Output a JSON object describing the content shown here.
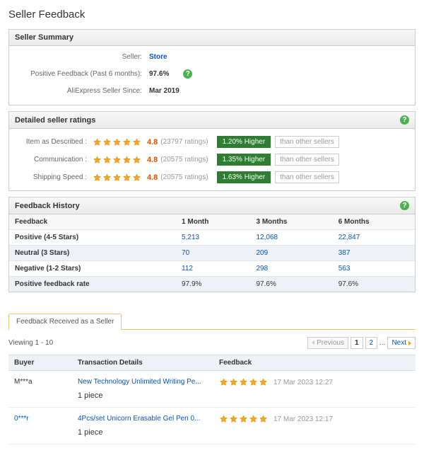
{
  "page_title": "Seller Feedback",
  "summary": {
    "header": "Seller Summary",
    "rows": {
      "seller_label": "Seller:",
      "seller_value": "Store",
      "positive_label": "Positive Feedback (Past 6 months):",
      "positive_value": "97.6%",
      "since_label": "AliExpress Seller Since:",
      "since_value": "Mar 2019"
    }
  },
  "detailed": {
    "header": "Detailed seller ratings",
    "rows": [
      {
        "label": "Item as Described :",
        "score": "4.8",
        "count": "(23797 ratings)",
        "badge": "1.20% Higher",
        "vs": "than other sellers"
      },
      {
        "label": "Communication :",
        "score": "4.8",
        "count": "(20575 ratings)",
        "badge": "1.35% Higher",
        "vs": "than other sellers"
      },
      {
        "label": "Shipping Speed :",
        "score": "4.8",
        "count": "(20575 ratings)",
        "badge": "1.63% Higher",
        "vs": "than other sellers"
      }
    ]
  },
  "history": {
    "header": "Feedback History",
    "cols": [
      "Feedback",
      "1 Month",
      "3 Months",
      "6 Months"
    ],
    "rows": [
      {
        "label": "Positive (4-5 Stars)",
        "v1": "5,213",
        "v2": "12,068",
        "v3": "22,847",
        "link": true
      },
      {
        "label": "Neutral (3 Stars)",
        "v1": "70",
        "v2": "209",
        "v3": "387",
        "link": true,
        "alt": true
      },
      {
        "label": "Negative (1-2 Stars)",
        "v1": "112",
        "v2": "298",
        "v3": "563",
        "link": true
      },
      {
        "label": "Positive feedback rate",
        "v1": "97.9%",
        "v2": "97.6%",
        "v3": "97.6%",
        "alt": true
      }
    ]
  },
  "feedback_list": {
    "tab_label": "Feedback Received as a Seller",
    "viewing": "Viewing 1 - 10",
    "pagination": {
      "prev": "Previous",
      "pages": [
        "1",
        "2"
      ],
      "ellipsis": "...",
      "next": "Next"
    },
    "cols": [
      "Buyer",
      "Transaction Details",
      "Feedback"
    ],
    "items": [
      {
        "buyer": "M***a",
        "buyer_dark": true,
        "trans": "New Technology Unlimited Writing Pe...",
        "qty": "1 piece",
        "date": "17 Mar 2023 12:27"
      },
      {
        "buyer": "0***r",
        "buyer_dark": false,
        "trans": "4Pcs/set Unicorn Erasable Gel Pen 0...",
        "qty": "1 piece",
        "date": "17 Mar 2023 12:17"
      }
    ]
  }
}
